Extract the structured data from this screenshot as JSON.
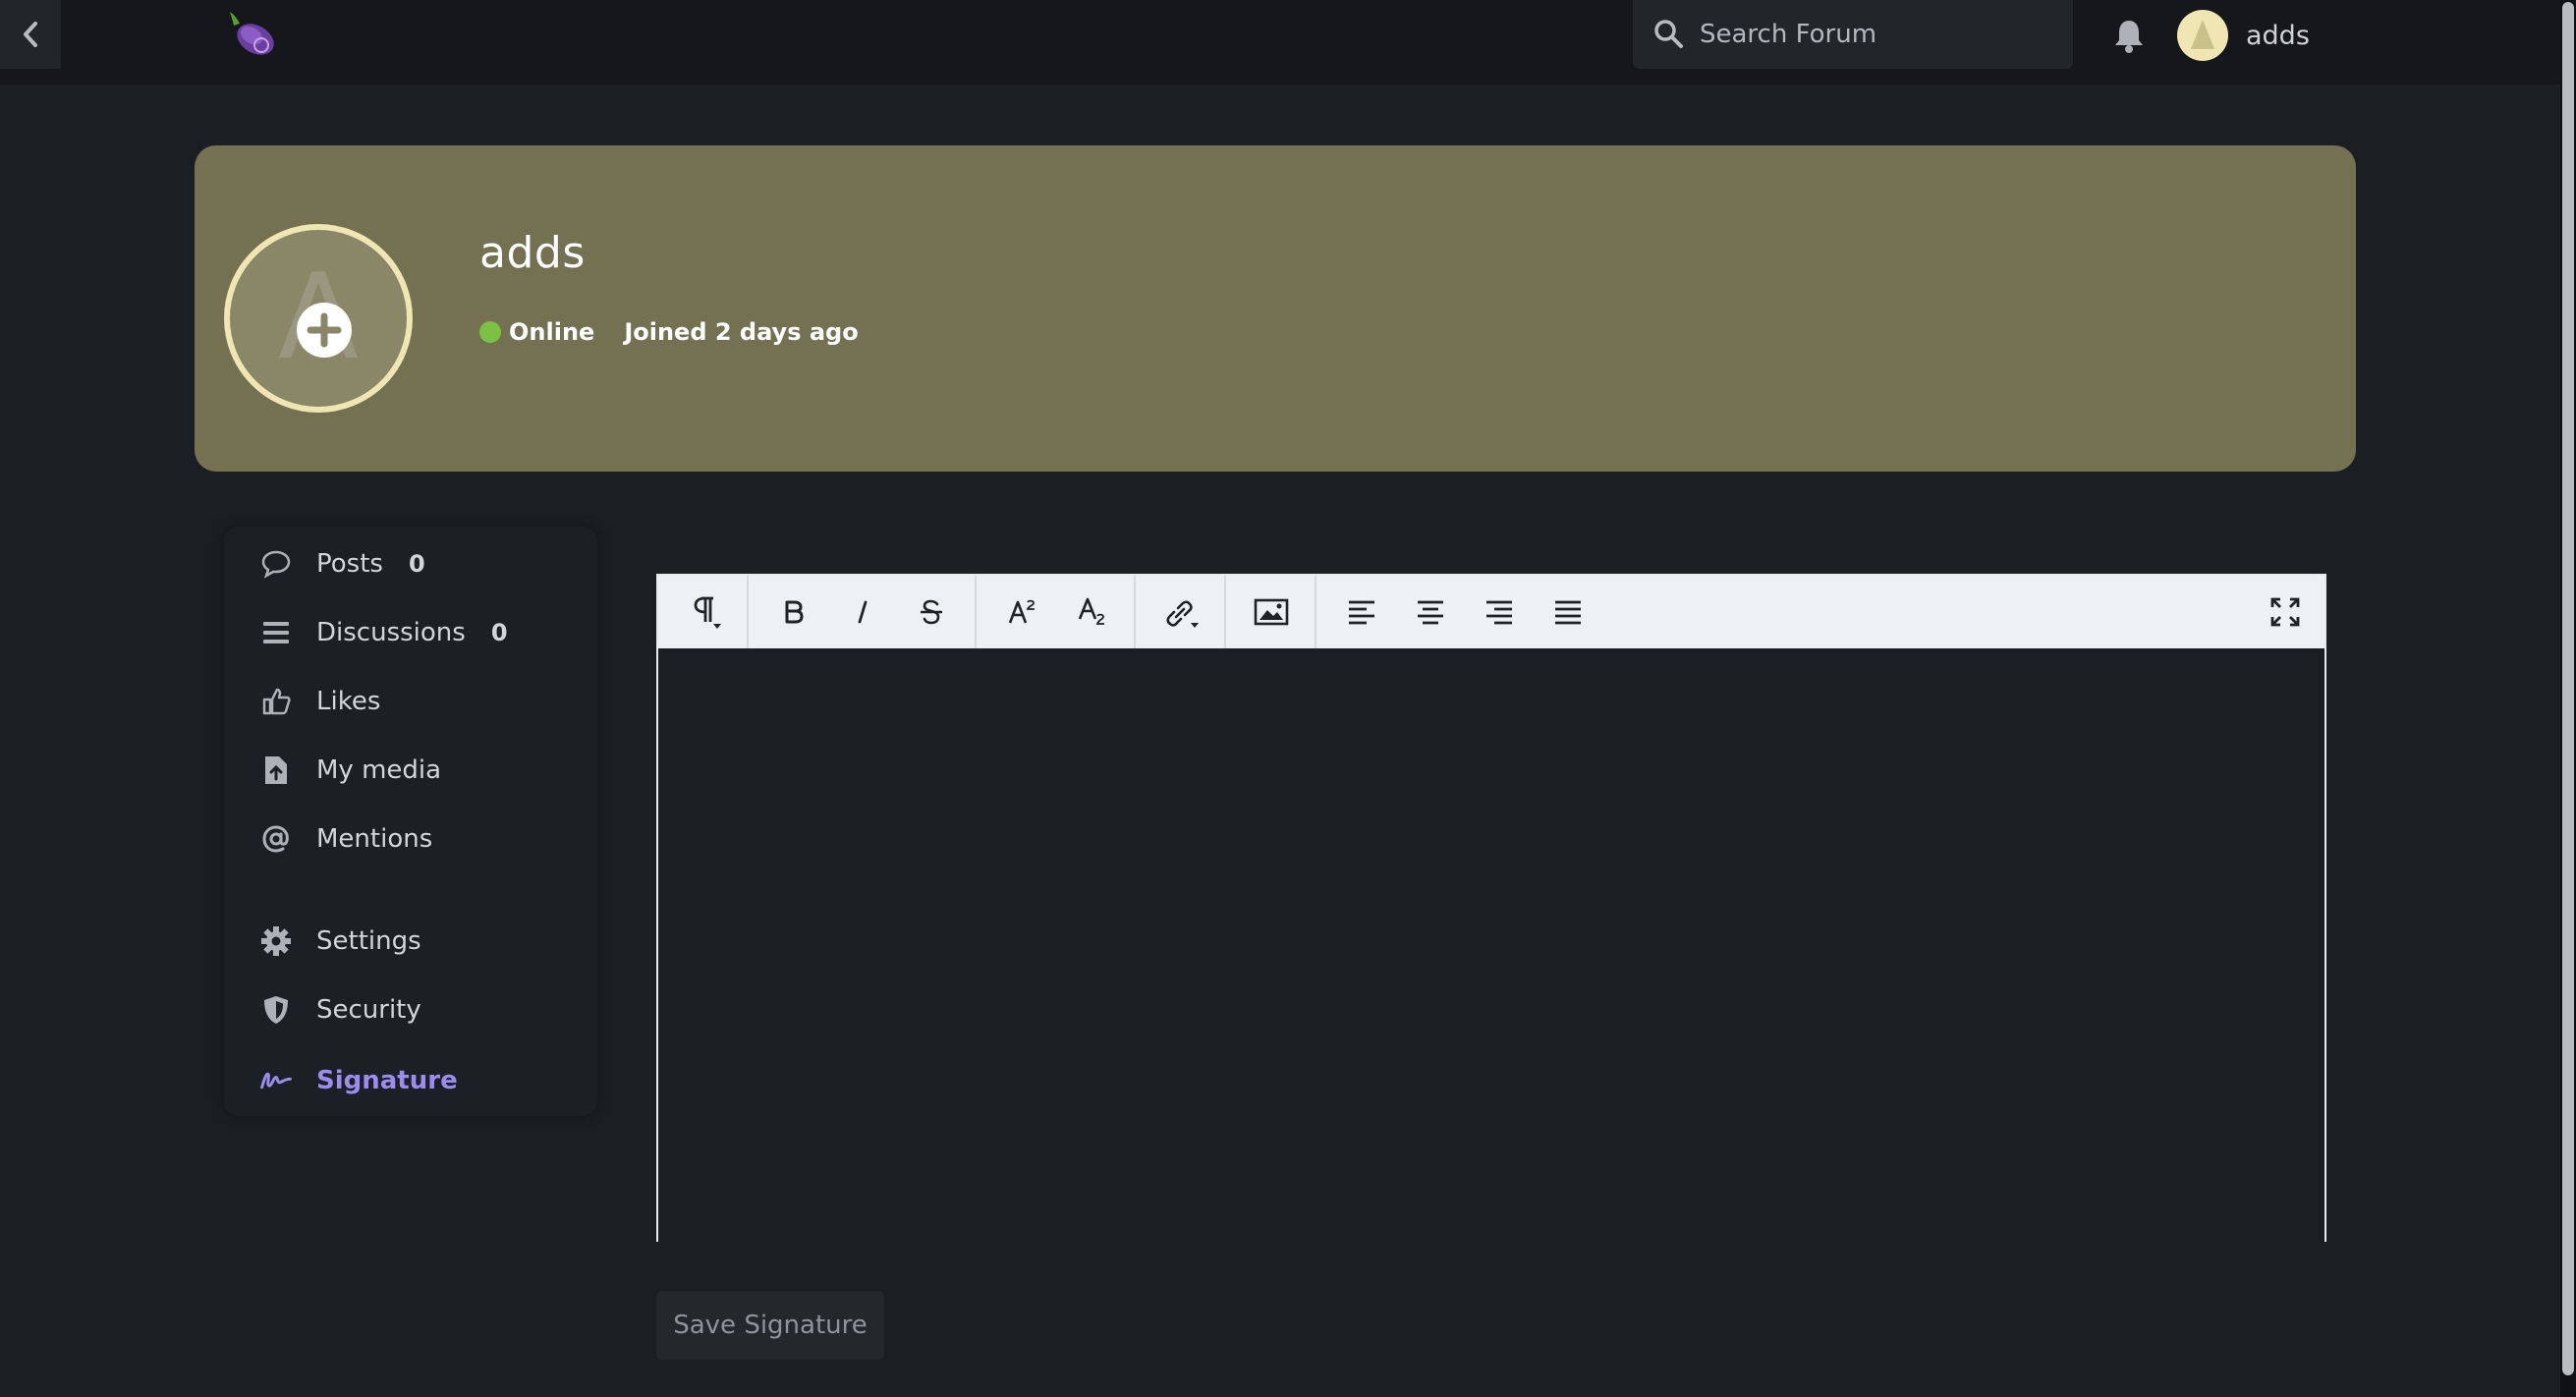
{
  "header": {
    "search_placeholder": "Search Forum",
    "user_name": "adds",
    "icons": {
      "back": "chevron-left-icon",
      "logo": "eggplant-logo",
      "search": "search-icon",
      "notifications": "bell-icon"
    }
  },
  "profile": {
    "username": "adds",
    "status": "Online",
    "joined": "Joined 2 days ago",
    "avatar_letter": "A",
    "colors": {
      "hero_background": "#747153",
      "avatar_ring": "#efe6b3",
      "online": "#7bc142"
    }
  },
  "nav": {
    "items": [
      {
        "label": "Posts",
        "count": "0",
        "icon": "comment-icon"
      },
      {
        "label": "Discussions",
        "count": "0",
        "icon": "list-icon"
      },
      {
        "label": "Likes",
        "icon": "thumbs-up-icon"
      },
      {
        "label": "My media",
        "icon": "file-upload-icon"
      },
      {
        "label": "Mentions",
        "icon": "at-icon"
      },
      {
        "label": "Settings",
        "icon": "gear-icon"
      },
      {
        "label": "Security",
        "icon": "shield-icon"
      },
      {
        "label": "Signature",
        "icon": "signature-icon",
        "active": true
      }
    ],
    "active_color": "#9c8cf0"
  },
  "editor": {
    "toolbar": [
      "paragraph-format-icon",
      "bold-icon",
      "italic-icon",
      "strikethrough-icon",
      "superscript-icon",
      "subscript-icon",
      "link-icon",
      "image-icon",
      "align-left-icon",
      "align-center-icon",
      "align-right-icon",
      "align-justify-icon",
      "fullscreen-icon"
    ],
    "content": ""
  },
  "actions": {
    "save_label": "Save Signature"
  }
}
